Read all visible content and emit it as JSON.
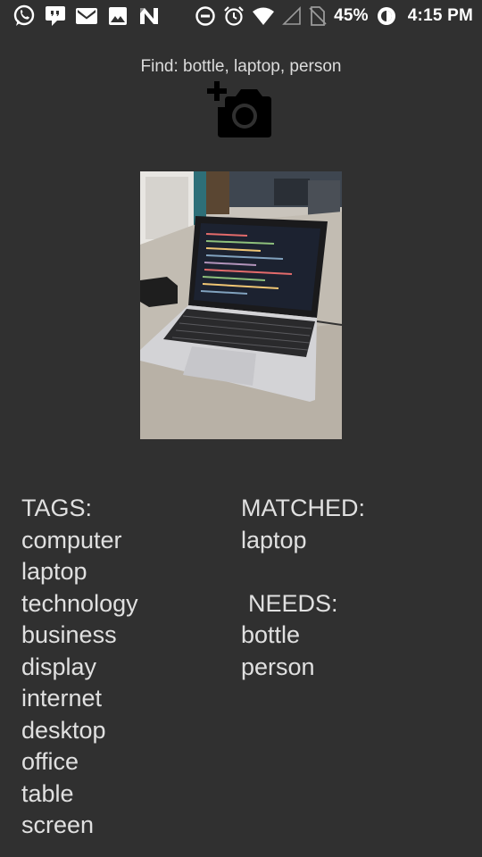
{
  "status_bar": {
    "left_icons": [
      "whatsapp-icon",
      "hangouts-icon",
      "gmail-icon",
      "gallery-icon",
      "n-icon"
    ],
    "right_icons": [
      "dnd-icon",
      "alarm-icon",
      "wifi-icon",
      "signal-icon",
      "no-sim-icon"
    ],
    "battery_percent": "45%",
    "time": "4:15 PM"
  },
  "find_text": "Find: bottle, laptop, person",
  "add_photo_icon": "add-a-photo-icon",
  "photo": {
    "subject": "laptop"
  },
  "tags": {
    "heading": "TAGS:",
    "items": [
      "computer",
      "laptop",
      "technology",
      "business",
      "display",
      "internet",
      "desktop",
      "office",
      "table",
      "screen"
    ]
  },
  "matched": {
    "heading": "MATCHED:",
    "items": [
      "laptop"
    ]
  },
  "needs": {
    "heading": "NEEDS:",
    "items": [
      "bottle",
      "person"
    ]
  },
  "colors": {
    "background": "#303030",
    "text": "#e0e0e0",
    "status_text": "#ffffff"
  }
}
